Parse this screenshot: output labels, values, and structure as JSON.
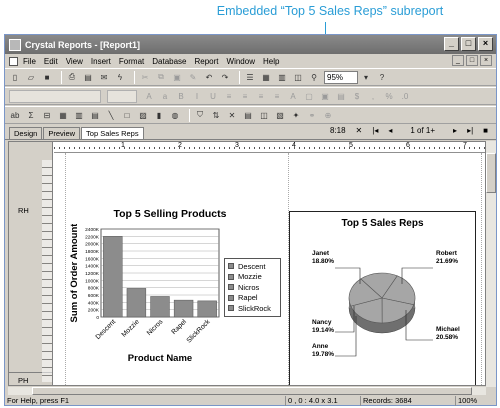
{
  "callout": "Embedded “Top 5 Sales Reps” subreport",
  "window": {
    "title": "Crystal Reports - [Report1]"
  },
  "menu": [
    "File",
    "Edit",
    "View",
    "Insert",
    "Format",
    "Database",
    "Report",
    "Window",
    "Help"
  ],
  "toolbar": {
    "zoom": "95%"
  },
  "tabs": [
    "Design",
    "Preview",
    "Top Sales Reps"
  ],
  "nav": {
    "time": "8:18",
    "page": "1 of 1+"
  },
  "sections": {
    "rh": "RH",
    "ph": "PH"
  },
  "ruler_numbers": [
    "1",
    "2",
    "3",
    "4",
    "5",
    "6",
    "7"
  ],
  "chart_data": [
    {
      "type": "bar",
      "title": "Top 5 Selling Products",
      "xlabel": "Product Name",
      "ylabel": "Sum of Order Amount",
      "categories": [
        "Descent",
        "Mozzie",
        "Nicros",
        "Rapel",
        "SlickRock"
      ],
      "values": [
        2200000,
        780000,
        560000,
        460000,
        440000
      ],
      "yticks": [
        "0",
        "200K",
        "400K",
        "600K",
        "800K",
        "1000K",
        "1200K",
        "1400K",
        "1600K",
        "1800K",
        "2000K",
        "2200K",
        "2400K"
      ],
      "ylim": [
        0,
        2400000
      ],
      "legend": [
        "Descent",
        "Mozzie",
        "Nicros",
        "Rapel",
        "SlickRock"
      ],
      "legend_position": "right"
    },
    {
      "type": "pie",
      "title": "Top 5 Sales Reps",
      "slices": [
        {
          "label": "Janet",
          "percent": "18.80%",
          "value": 18.8
        },
        {
          "label": "Robert",
          "percent": "21.69%",
          "value": 21.69
        },
        {
          "label": "Michael",
          "percent": "20.58%",
          "value": 20.58
        },
        {
          "label": "Anne",
          "percent": "19.78%",
          "value": 19.78
        },
        {
          "label": "Nancy",
          "percent": "19.14%",
          "value": 19.14
        }
      ]
    }
  ],
  "status": {
    "help": "For Help, press F1",
    "coords": "0 , 0 : 4.0 x 3.1",
    "records": "Records:  3684",
    "zoom": "100%"
  },
  "colors": {
    "callout": "#2a9dd6",
    "bar_fill": "#8c8c8c",
    "pie_fill": "#a6a6a6",
    "titlebar": "#7a7a7a"
  }
}
